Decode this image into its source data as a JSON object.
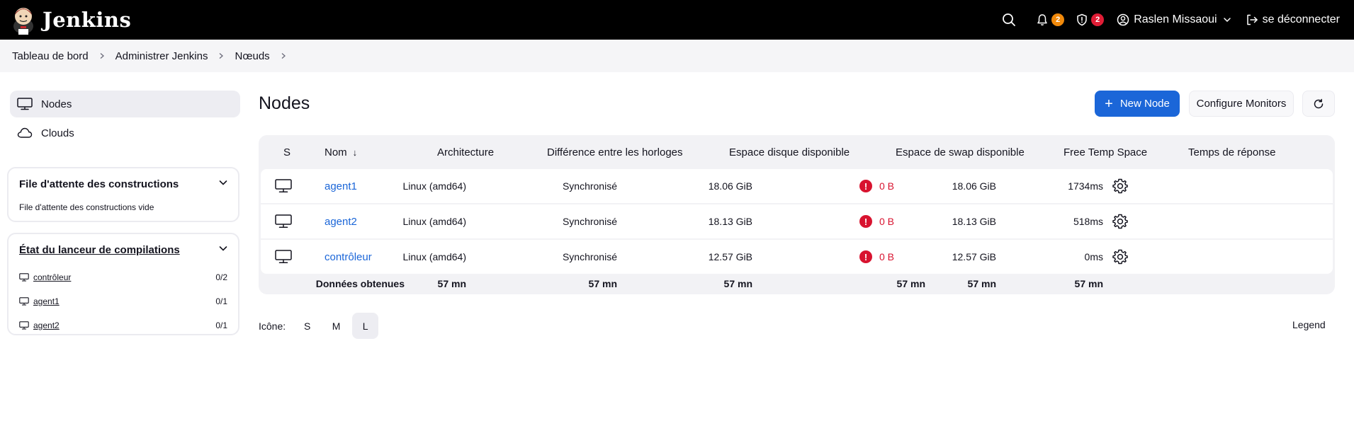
{
  "header": {
    "title": "Jenkins",
    "notifications_count": "2",
    "security_count": "2",
    "user_name": "Raslen Missaoui",
    "logout_label": "se déconnecter"
  },
  "breadcrumb": [
    "Tableau de bord",
    "Administrer Jenkins",
    "Nœuds"
  ],
  "sidebar": {
    "nav": [
      {
        "label": "Nodes",
        "icon": "computer-icon",
        "active": true
      },
      {
        "label": "Clouds",
        "icon": "cloud-icon",
        "active": false
      }
    ],
    "build_queue": {
      "title": "File d'attente des constructions",
      "empty_text": "File d'attente des constructions vide"
    },
    "executors": {
      "title": "État du lanceur de compilations",
      "items": [
        {
          "name": "contrôleur",
          "count": "0/2"
        },
        {
          "name": "agent1",
          "count": "0/1"
        },
        {
          "name": "agent2",
          "count": "0/1"
        }
      ]
    }
  },
  "main": {
    "title": "Nodes",
    "new_node_label": "New Node",
    "configure_monitors_label": "Configure Monitors",
    "table": {
      "headers": {
        "s": "S",
        "name": "Nom",
        "sort_indicator": "↓",
        "architecture": "Architecture",
        "clock_diff": "Différence entre les horloges",
        "disk": "Espace disque disponible",
        "swap": "Espace de swap disponible",
        "temp": "Free Temp Space",
        "response": "Temps de réponse"
      },
      "rows": [
        {
          "name": "agent1",
          "architecture": "Linux (amd64)",
          "clock_diff": "Synchronisé",
          "disk": "18.06 GiB",
          "swap": "0 B",
          "temp": "18.06 GiB",
          "response": "1734ms"
        },
        {
          "name": "agent2",
          "architecture": "Linux (amd64)",
          "clock_diff": "Synchronisé",
          "disk": "18.13 GiB",
          "swap": "0 B",
          "temp": "18.13 GiB",
          "response": "518ms"
        },
        {
          "name": "contrôleur",
          "architecture": "Linux (amd64)",
          "clock_diff": "Synchronisé",
          "disk": "12.57 GiB",
          "swap": "0 B",
          "temp": "12.57 GiB",
          "response": "0ms"
        }
      ],
      "footer": {
        "label": "Données obtenues",
        "architecture": "57 mn",
        "clock_diff": "57 mn",
        "disk": "57 mn",
        "swap": "57 mn",
        "temp": "57 mn",
        "response": "57 mn"
      }
    },
    "icon_size": {
      "label": "Icône:",
      "options": [
        "S",
        "M",
        "L"
      ],
      "selected": "L"
    },
    "legend_label": "Legend"
  },
  "colors": {
    "header_bg": "#000000",
    "primary": "#1b66d8",
    "warning": "#d8132f",
    "badge_orange": "#f0890b",
    "badge_red": "#e01d36"
  }
}
